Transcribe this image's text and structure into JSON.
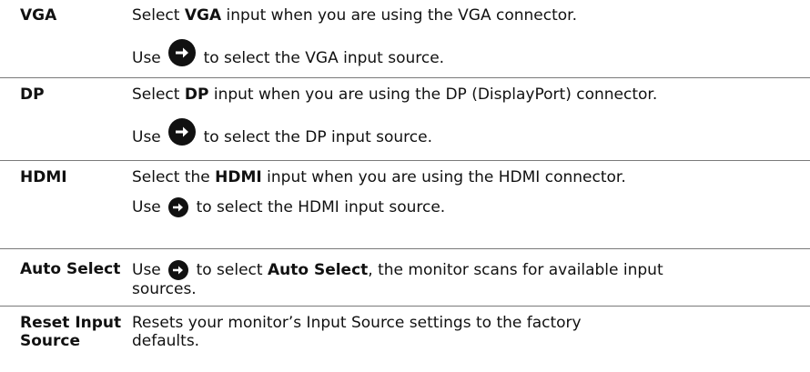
{
  "rows": [
    {
      "term": "VGA",
      "p1": {
        "a": "Select ",
        "b": "VGA",
        "c": " input when you are using the VGA connector."
      },
      "p2": {
        "a": "Use ",
        "c": " to select the VGA input source."
      }
    },
    {
      "term": "DP",
      "p1": {
        "a": "Select ",
        "b": "DP",
        "c": " input when you are using the DP (DisplayPort) connector."
      },
      "p2": {
        "a": "Use ",
        "c": " to select the DP input source."
      }
    },
    {
      "term": "HDMI",
      "p1": {
        "a": "Select the ",
        "b": "HDMI",
        "c": " input when you are using the HDMI connector."
      },
      "p2": {
        "a": "Use ",
        "c": " to select the HDMI input source."
      }
    },
    {
      "term": "Auto Select",
      "p1": {
        "a": "Use ",
        "b1": " to select ",
        "b": "Auto Select",
        "c": ", the monitor scans for available input sources."
      }
    },
    {
      "term": "Reset Input Source",
      "p1": {
        "a": "Resets your monitor’s Input Source settings to the factory defaults."
      }
    }
  ],
  "icons": {
    "arrow": "arrow-right-circle-icon"
  }
}
